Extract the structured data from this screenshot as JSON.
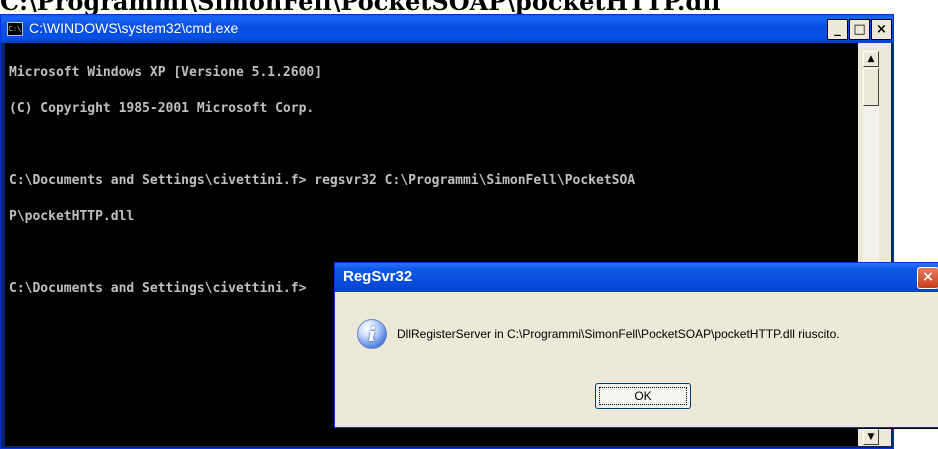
{
  "doc_snippet": "C:\\Programmi\\SimonFell\\PocketSOAP\\pocketHTTP.dll",
  "cmd": {
    "title": "C:\\WINDOWS\\system32\\cmd.exe",
    "icon": "cmd-icon",
    "caption_buttons": {
      "minimize": "_",
      "maximize": "□",
      "close": "×"
    },
    "lines": [
      "Microsoft Windows XP [Versione 5.1.2600]",
      "(C) Copyright 1985-2001 Microsoft Corp.",
      "",
      "C:\\Documents and Settings\\civettini.f> regsvr32 C:\\Programmi\\SimonFell\\PocketSOA",
      "P\\pocketHTTP.dll",
      "",
      "C:\\Documents and Settings\\civettini.f>"
    ],
    "colors": {
      "background": "#000000",
      "text": "#c0c0c0",
      "titlebar": "#0a4ee3"
    }
  },
  "dialog": {
    "title": "RegSvr32",
    "icon": "info-icon",
    "message": "DllRegisterServer in C:\\Programmi\\SimonFell\\PocketSOAP\\pocketHTTP.dll riuscito.",
    "ok_label": "OK",
    "close_label": "×"
  }
}
